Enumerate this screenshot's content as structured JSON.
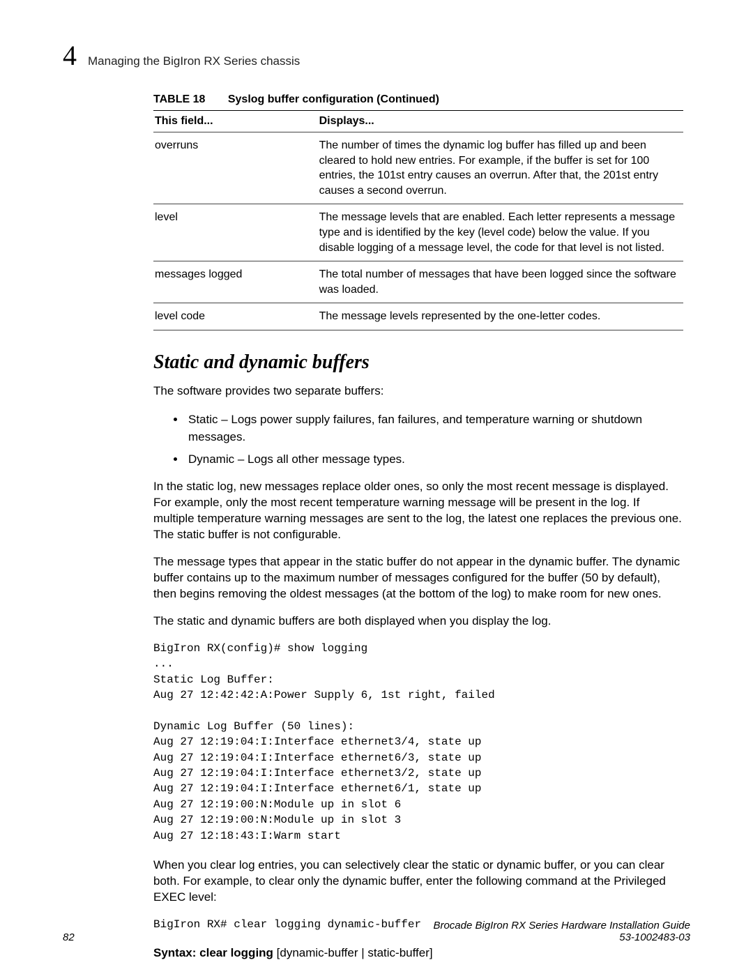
{
  "header": {
    "chapter_number": "4",
    "chapter_title": "Managing the BigIron RX Series chassis"
  },
  "table": {
    "caption_label": "TABLE 18",
    "caption_text": "Syslog buffer configuration  (Continued)",
    "col_field": "This field...",
    "col_displays": "Displays...",
    "rows": [
      {
        "field": "overruns",
        "displays": "The number of times the dynamic log buffer has filled up and been cleared to hold new entries. For example, if the buffer is set for 100 entries, the 101st entry causes an overrun. After that, the 201st entry causes a second overrun."
      },
      {
        "field": "level",
        "displays": "The message levels that are enabled. Each letter represents a message type and is identified by the key (level code) below the value. If you disable logging of a message level, the code for that level is not listed."
      },
      {
        "field": "messages logged",
        "displays": "The total number of messages that have been logged since the software was loaded."
      },
      {
        "field": "level code",
        "displays": "The message levels represented by the one-letter codes."
      }
    ]
  },
  "section": {
    "heading": "Static and dynamic buffers",
    "intro": "The software provides two separate buffers:",
    "bullets": [
      "Static – Logs power supply failures, fan failures, and temperature warning or shutdown messages.",
      "Dynamic – Logs all other message types."
    ],
    "para1": "In the static log, new messages replace older ones, so only the most recent message is displayed. For example, only the most recent temperature warning message will be present in the log. If multiple temperature warning messages are sent to the log, the latest one replaces the previous one. The static buffer is not configurable.",
    "para2": "The message types that appear in the static buffer do not appear in the dynamic buffer. The dynamic buffer contains up to the maximum number of messages configured for the buffer (50 by default), then begins removing the oldest messages (at the bottom of the log) to make room for new ones.",
    "para3": "The static and dynamic buffers are both displayed when you display the log.",
    "code1": "BigIron RX(config)# show logging\n...\nStatic Log Buffer:\nAug 27 12:42:42:A:Power Supply 6, 1st right, failed\n\nDynamic Log Buffer (50 lines):\nAug 27 12:19:04:I:Interface ethernet3/4, state up\nAug 27 12:19:04:I:Interface ethernet6/3, state up\nAug 27 12:19:04:I:Interface ethernet3/2, state up\nAug 27 12:19:04:I:Interface ethernet6/1, state up\nAug 27 12:19:00:N:Module up in slot 6\nAug 27 12:19:00:N:Module up in slot 3\nAug 27 12:18:43:I:Warm start",
    "para4": "When you clear log entries, you can selectively clear the static or dynamic buffer, or you can clear both. For example, to clear only the dynamic buffer, enter the following command at the Privileged EXEC level:",
    "code2": "BigIron RX# clear logging dynamic-buffer",
    "syntax_prefix": "Syntax:  ",
    "syntax_bold": "clear logging",
    "syntax_rest": " [dynamic-buffer | static-buffer]"
  },
  "footer": {
    "page_num": "82",
    "guide": "Brocade BigIron RX Series Hardware Installation Guide",
    "docnum": "53-1002483-03"
  }
}
